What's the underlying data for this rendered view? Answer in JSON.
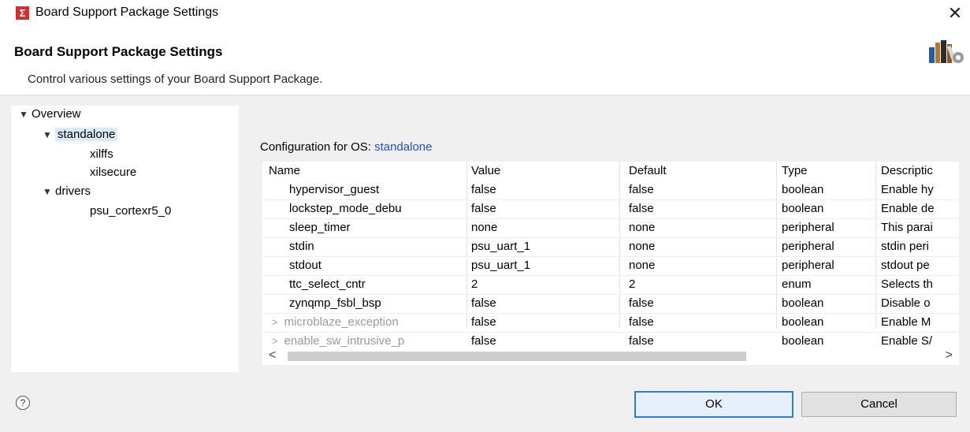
{
  "window": {
    "title": "Board Support Package Settings",
    "icons": {
      "app": "xilinx-logo-icon",
      "close": "close-icon"
    }
  },
  "header": {
    "title": "Board Support Package Settings",
    "description": "Control various settings of your Board Support Package.",
    "icon": "books-gear-icon"
  },
  "tree": {
    "items": [
      {
        "label": "Overview",
        "expanded": true
      },
      {
        "label": "standalone",
        "expanded": true,
        "selected": true
      },
      {
        "label": "xilffs"
      },
      {
        "label": "xilsecure"
      },
      {
        "label": "drivers",
        "expanded": true
      },
      {
        "label": "psu_cortexr5_0"
      }
    ]
  },
  "config": {
    "prefix": "Configuration for OS:",
    "os": "standalone"
  },
  "table": {
    "columns": [
      "Name",
      "Value",
      "Default",
      "Type",
      "Descriptic"
    ],
    "rows": [
      {
        "name": "hypervisor_guest",
        "value": "false",
        "default": "false",
        "type": "boolean",
        "description": "Enable hy"
      },
      {
        "name": "lockstep_mode_debu",
        "value": "false",
        "default": "false",
        "type": "boolean",
        "description": "Enable de"
      },
      {
        "name": "sleep_timer",
        "value": "none",
        "default": "none",
        "type": "peripheral",
        "description": "This parai"
      },
      {
        "name": "stdin",
        "value": "psu_uart_1",
        "default": "none",
        "type": "peripheral",
        "description": "stdin peri"
      },
      {
        "name": "stdout",
        "value": "psu_uart_1",
        "default": "none",
        "type": "peripheral",
        "description": "stdout pe"
      },
      {
        "name": "ttc_select_cntr",
        "value": "2",
        "default": "2",
        "type": "enum",
        "description": "Selects th"
      },
      {
        "name": "zynqmp_fsbl_bsp",
        "value": "false",
        "default": "false",
        "type": "boolean",
        "description": "Disable o"
      },
      {
        "name": "microblaze_exception",
        "value": "false",
        "default": "false",
        "type": "boolean",
        "description": "Enable M",
        "expandable": true
      },
      {
        "name": "enable_sw_intrusive_p",
        "value": "false",
        "default": "false",
        "type": "boolean",
        "description": "Enable S/",
        "expandable": true
      }
    ]
  },
  "scrollbar": {
    "left": "<",
    "right": ">"
  },
  "buttons": {
    "ok": "OK",
    "cancel": "Cancel",
    "help": "?"
  },
  "colors": {
    "accent": "#2f7cd3",
    "selection": "#d9ebf9",
    "link": "#1f4fd0"
  }
}
